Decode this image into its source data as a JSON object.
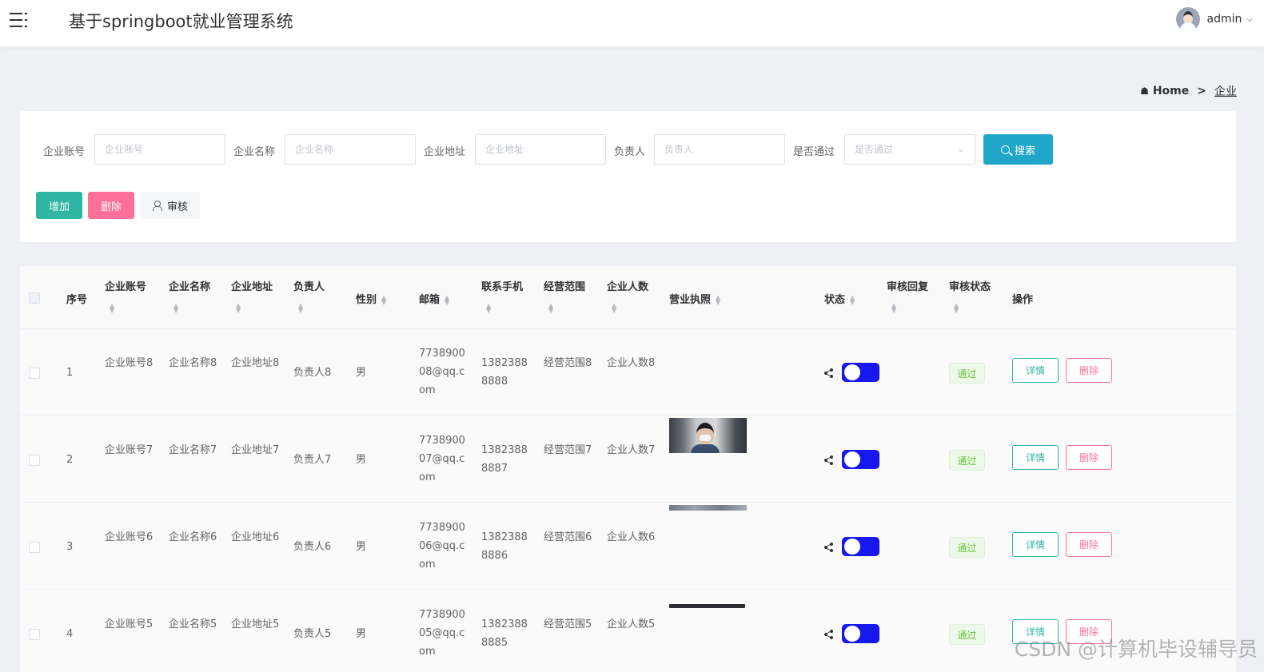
{
  "app": {
    "title": "基于springboot就业管理系统",
    "user": "admin"
  },
  "breadcrumb": {
    "home": "Home",
    "separator": ">",
    "current": "企业"
  },
  "filters": [
    {
      "label": "企业账号",
      "placeholder": "企业账号"
    },
    {
      "label": "企业名称",
      "placeholder": "企业名称"
    },
    {
      "label": "企业地址",
      "placeholder": "企业地址"
    },
    {
      "label": "负责人",
      "placeholder": "负责人"
    },
    {
      "label": "是否通过",
      "placeholder": "是否通过"
    }
  ],
  "search_label": "搜索",
  "actions": {
    "add": "增加",
    "delete": "删除",
    "audit": "审核"
  },
  "columns": {
    "index": "序号",
    "account": "企业账号",
    "name": "企业名称",
    "address": "企业地址",
    "owner": "负责人",
    "gender": "性别",
    "email": "邮箱",
    "phone": "联系手机",
    "scope": "经营范围",
    "staff": "企业人数",
    "license": "营业执照",
    "status": "状态",
    "reply": "审核回复",
    "audit_status": "审核状态",
    "ops": "操作"
  },
  "rows": [
    {
      "index": "1",
      "account": "企业账号8",
      "name": "企业名称8",
      "address": "企业地址8",
      "owner": "负责人8",
      "gender": "男",
      "email": "773890008@qq.com",
      "phone": "13823888888",
      "scope": "经营范围8",
      "staff": "企业人数8",
      "license": "none",
      "status": true,
      "audit_status": "通过",
      "detail": "详情",
      "delete": "删除"
    },
    {
      "index": "2",
      "account": "企业账号7",
      "name": "企业名称7",
      "address": "企业地址7",
      "owner": "负责人7",
      "gender": "男",
      "email": "773890007@qq.com",
      "phone": "13823888887",
      "scope": "经营范围7",
      "staff": "企业人数7",
      "license": "photo",
      "status": true,
      "audit_status": "通过",
      "detail": "详情",
      "delete": "删除"
    },
    {
      "index": "3",
      "account": "企业账号6",
      "name": "企业名称6",
      "address": "企业地址6",
      "owner": "负责人6",
      "gender": "男",
      "email": "773890006@qq.com",
      "phone": "13823888886",
      "scope": "经营范围6",
      "staff": "企业人数6",
      "license": "strip",
      "status": true,
      "audit_status": "通过",
      "detail": "详情",
      "delete": "删除"
    },
    {
      "index": "4",
      "account": "企业账号5",
      "name": "企业名称5",
      "address": "企业地址5",
      "owner": "负责人5",
      "gender": "男",
      "email": "773890005@qq.com",
      "phone": "13823888885",
      "scope": "经营范围5",
      "staff": "企业人数5",
      "license": "bar",
      "status": true,
      "audit_status": "通过",
      "detail": "详情",
      "delete": "删除"
    }
  ],
  "watermark": "CSDN @计算机毕设辅导员",
  "colors": {
    "accent": "#1fa6c9",
    "add": "#2eb5a3",
    "delete": "#ff6f97",
    "toggle": "#1717ee",
    "pass_tag": "#67c23a"
  }
}
